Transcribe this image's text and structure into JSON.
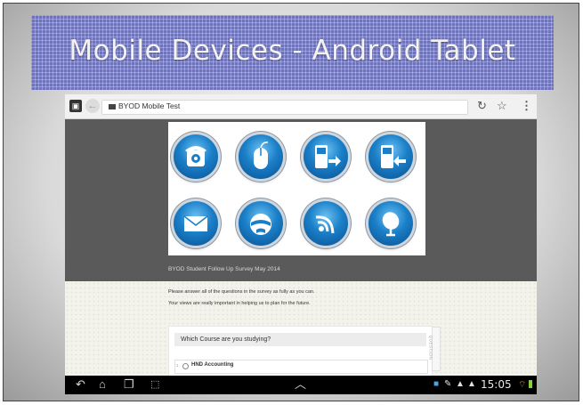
{
  "slide": {
    "title": "Mobile Devices - Android Tablet"
  },
  "browser": {
    "url": "BYOD Mobile Test",
    "icons": [
      "tab-switcher-icon",
      "back-arrow-icon",
      "reload-icon",
      "bookmark-star-icon",
      "overflow-menu-icon"
    ]
  },
  "page": {
    "header_image_icons": [
      "telephone-icon",
      "mouse-icon",
      "phone-arrow-right-icon",
      "phone-arrow-left-icon",
      "envelope-icon",
      "globe-icon",
      "wireless-signal-icon",
      "satellite-dish-icon"
    ],
    "survey_title": "BYOD Student Follow Up Survey May 2014",
    "intro_line1": "Please answer all of the questions in the survey as fully as you can.",
    "intro_line2": "Your views are really important in helping us to plan for the future.",
    "question": "Which Course are you studying?",
    "side_tab": "QUESTION",
    "option_number": "1",
    "option_label": "HND Accounting"
  },
  "status_bar": {
    "time": "15:05",
    "colors": {
      "battery": "#7fd43a",
      "wifi": "#f2a33a"
    },
    "icons": [
      "back-nav-icon",
      "home-nav-icon",
      "recent-apps-icon",
      "screenshot-icon",
      "up-chevron-icon",
      "notification-icon",
      "pencil-icon",
      "warning-icon",
      "wifi-icon",
      "battery-icon"
    ]
  }
}
